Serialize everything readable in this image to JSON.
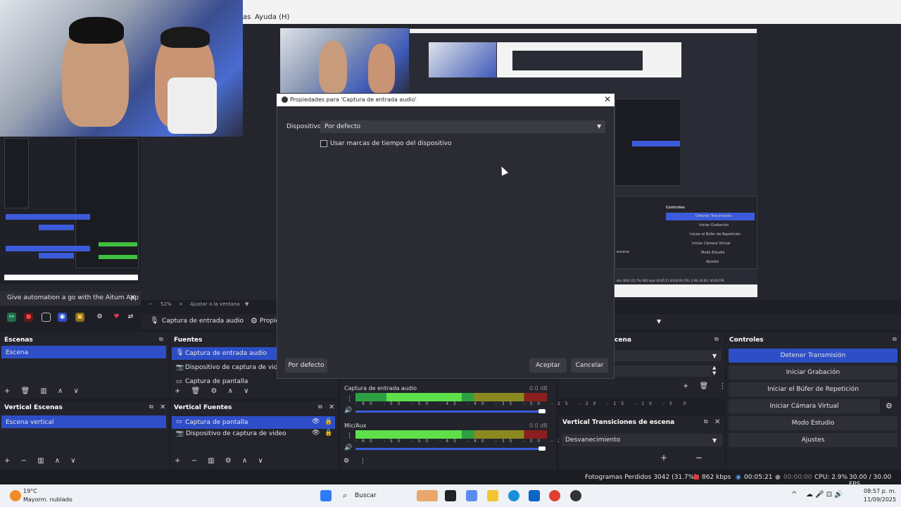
{
  "menu": {
    "item_partial": "as",
    "help": "Ayuda (H)"
  },
  "aitum": {
    "banner": "Give automation a go with the Aitum App",
    "close": "✕"
  },
  "zoom": {
    "minus": "−",
    "value": "52%",
    "plus": "+",
    "fit": "Ajustar a la ventana"
  },
  "source_toolbar": {
    "source_name": "Captura de entrada audio",
    "properties_label": "Propie"
  },
  "scenes": {
    "title": "Escenas",
    "items": [
      "Escena"
    ]
  },
  "sources": {
    "title": "Fuentes",
    "items": [
      "Captura de entrada audio",
      "Dispositivo de captura de video",
      "Captura de pantalla"
    ]
  },
  "vertical_scenes": {
    "title": "Vertical Escenas",
    "items": [
      "Escena vertical"
    ]
  },
  "vertical_sources": {
    "title": "Vertical Fuentes",
    "items": [
      "Captura de pantalla",
      "Dispositivo de captura de video"
    ]
  },
  "transitions": {
    "title_partial": "cena",
    "vertical_title": "Vertical Transiciones de escena",
    "vertical_value": "Desvanecimiento"
  },
  "controls": {
    "title": "Controles",
    "buttons": [
      "Detener Transmisión",
      "Iniciar Grabación",
      "Iniciar el Búfer de Repetición",
      "Iniciar Cámara Virtual",
      "Modo Estudio",
      "Ajustes"
    ]
  },
  "mixer": {
    "ticks": "-60 -55 -50 -45 -40 -35 -30 -25 -20 -15 -10 -5 0",
    "channels": [
      {
        "name": "Captura de entrada audio",
        "db": "0.0 dB"
      },
      {
        "name": "Mic/Aux",
        "db": "0.0 dB"
      }
    ]
  },
  "status": {
    "dropped": "Fotogramas Perdidos 3042 (31.7%)",
    "kbps": "862 kbps",
    "stream_time": "00:05:21",
    "rec_time": "00:00:00",
    "cpu": "CPU: 2.9%",
    "fps": "30.00 / 30.00 FPS"
  },
  "dialog": {
    "title": "Propiedades para 'Captura de entrada audio'",
    "device_label": "Dispositivo",
    "device_value": "Por defecto",
    "timestamp_label": "Usar marcas de tiempo del dispositivo",
    "defaults_button": "Por defecto",
    "ok_button": "Aceptar",
    "cancel_button": "Cancelar"
  },
  "taskbar": {
    "weather_temp": "19°C",
    "weather_desc": "Mayorm. nublado",
    "search": "Buscar",
    "time": "08:57 p. m.",
    "date": "11/09/2025"
  },
  "inner_preview": {
    "controls_title": "Controles",
    "buttons": [
      "Detener Transmisión",
      "Iniciar Grabación",
      "Iniciar el Búfer de Repetición",
      "Iniciar Cámara Virtual",
      "Modo Estudio",
      "Ajustes"
    ],
    "scene_label": "escena",
    "status_text": "dos 3042 (31.7%)  862 kbps  00:05:21  00:00:00  CPU: 2.9%  30.00 / 30.00 FPS"
  },
  "colors": {
    "accent": "#2e4ec7",
    "panel": "#23242b",
    "background": "#1e1f26"
  }
}
